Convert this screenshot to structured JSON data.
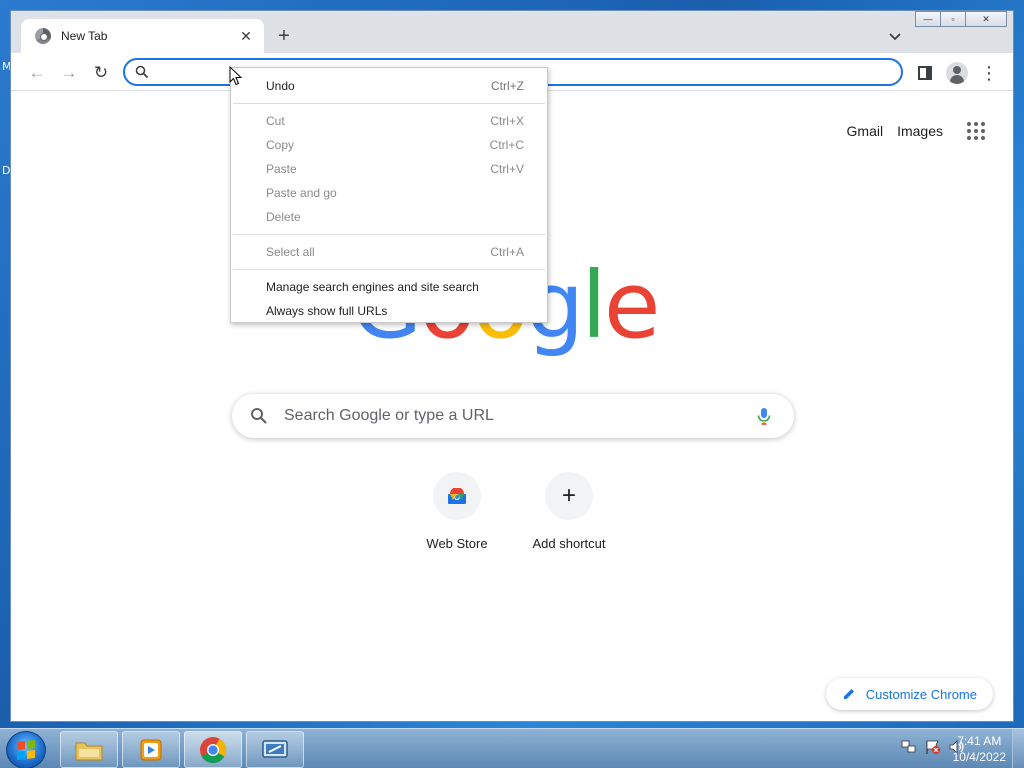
{
  "desktop": {
    "edge_labels": [
      "M",
      "D"
    ]
  },
  "browser": {
    "tab": {
      "title": "New Tab",
      "close_glyph": "✕"
    },
    "new_tab_glyph": "+",
    "tab_search_glyph": "⌄",
    "window_controls": {
      "minimize": "—",
      "maximize": "▫",
      "close": "✕"
    },
    "toolbar": {
      "back_glyph": "←",
      "forward_glyph": "→",
      "reload_glyph": "↻",
      "omnibox_value": "",
      "menu_glyph": "⋮"
    }
  },
  "ntp": {
    "top_links": {
      "gmail": "Gmail",
      "images": "Images"
    },
    "logo_letters": [
      "G",
      "o",
      "o",
      "g",
      "l",
      "e"
    ],
    "logo_colors": [
      "#4285f4",
      "#ea4335",
      "#fbbc05",
      "#4285f4",
      "#34a853",
      "#ea4335"
    ],
    "search_placeholder": "Search Google or type a URL",
    "shortcuts": [
      {
        "label": "Web Store"
      },
      {
        "label": "Add shortcut",
        "glyph": "+"
      }
    ],
    "customize_label": "Customize Chrome"
  },
  "context_menu": {
    "groups": [
      [
        {
          "label": "Undo",
          "shortcut": "Ctrl+Z",
          "disabled": false
        }
      ],
      [
        {
          "label": "Cut",
          "shortcut": "Ctrl+X",
          "disabled": true
        },
        {
          "label": "Copy",
          "shortcut": "Ctrl+C",
          "disabled": true
        },
        {
          "label": "Paste",
          "shortcut": "Ctrl+V",
          "disabled": true
        },
        {
          "label": "Paste and go",
          "shortcut": "",
          "disabled": true
        },
        {
          "label": "Delete",
          "shortcut": "",
          "disabled": true
        }
      ],
      [
        {
          "label": "Select all",
          "shortcut": "Ctrl+A",
          "disabled": true
        }
      ],
      [
        {
          "label": "Manage search engines and site search",
          "shortcut": "",
          "disabled": false
        },
        {
          "label": "Always show full URLs",
          "shortcut": "",
          "disabled": false
        }
      ]
    ]
  },
  "taskbar": {
    "apps": [
      "file-explorer",
      "media-player",
      "chrome",
      "remote-desktop"
    ],
    "clock": {
      "time": "7:41 AM",
      "date": "10/4/2022"
    }
  },
  "colors": {
    "accent": "#1a73e8",
    "tabstrip": "#dee1e6",
    "taskbar_top": "#8fb3d6",
    "taskbar_bottom": "#5c88b4"
  }
}
